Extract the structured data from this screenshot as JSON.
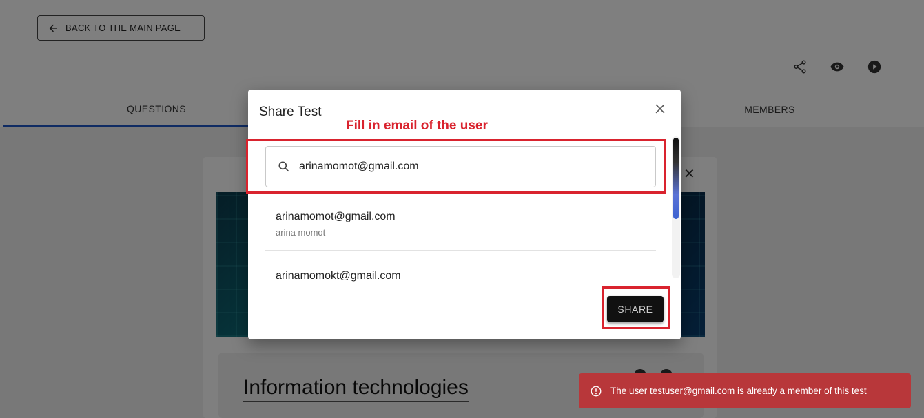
{
  "page": {
    "back_button_label": "BACK TO THE MAIN PAGE",
    "tabs": [
      {
        "label": "QUESTIONS"
      },
      {
        "label": "MEMBERS"
      }
    ],
    "test_title": "Information technologies",
    "top_icons": [
      "share-icon",
      "eye-icon",
      "play-icon"
    ]
  },
  "modal": {
    "title": "Share Test",
    "annotation": "Fill in email of the user",
    "search_value": "arinamomot@gmail.com",
    "results": [
      {
        "email": "arinamomot@gmail.com",
        "name": "arina momot"
      },
      {
        "email": "arinamomokt@gmail.com",
        "name": ""
      }
    ],
    "share_label": "SHARE"
  },
  "snackbar": {
    "message": "The user testuser@gmail.com is already a member of this test",
    "color": "#b8373a"
  },
  "colors": {
    "annotation": "#d9232e",
    "tab_underline": "#1e56c7"
  }
}
